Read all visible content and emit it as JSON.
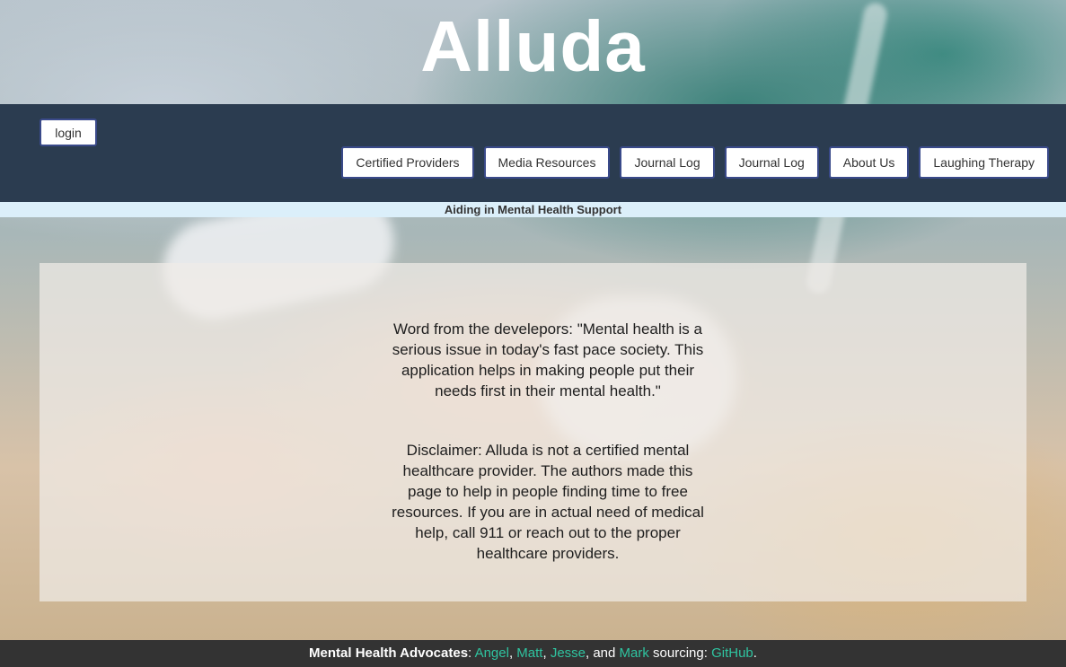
{
  "header": {
    "title": "Alluda",
    "tagline": "Aiding in Mental Health Support"
  },
  "nav": {
    "login_label": "login",
    "items": [
      {
        "label": "Certified Providers"
      },
      {
        "label": "Media Resources"
      },
      {
        "label": "Journal Log"
      },
      {
        "label": "Journal Log"
      },
      {
        "label": "About Us"
      },
      {
        "label": "Laughing Therapy"
      }
    ]
  },
  "main": {
    "developer_word": "Word from the develepors: \"Mental health is a serious issue in today's fast pace society. This application helps in making people put their needs first in their mental health.\"",
    "disclaimer": "Disclaimer: Alluda is not a certified mental healthcare provider. The authors made this page to help in people finding time to free resources. If you are in actual need of medical help, call 911 or reach out to the proper healthcare providers."
  },
  "footer": {
    "lead": "Mental Health Advocates",
    "colon": ": ",
    "authors": [
      "Angel",
      "Matt",
      "Jesse",
      "Mark"
    ],
    "sep": ", ",
    "and_text": ", and ",
    "sourcing_text": " sourcing: ",
    "source_link": "GitHub",
    "end": "."
  },
  "colors": {
    "navbar": "#2b3c50",
    "tagline_bg": "#dbeffa",
    "footer_bg": "#333333",
    "link": "#2fc4a0"
  }
}
